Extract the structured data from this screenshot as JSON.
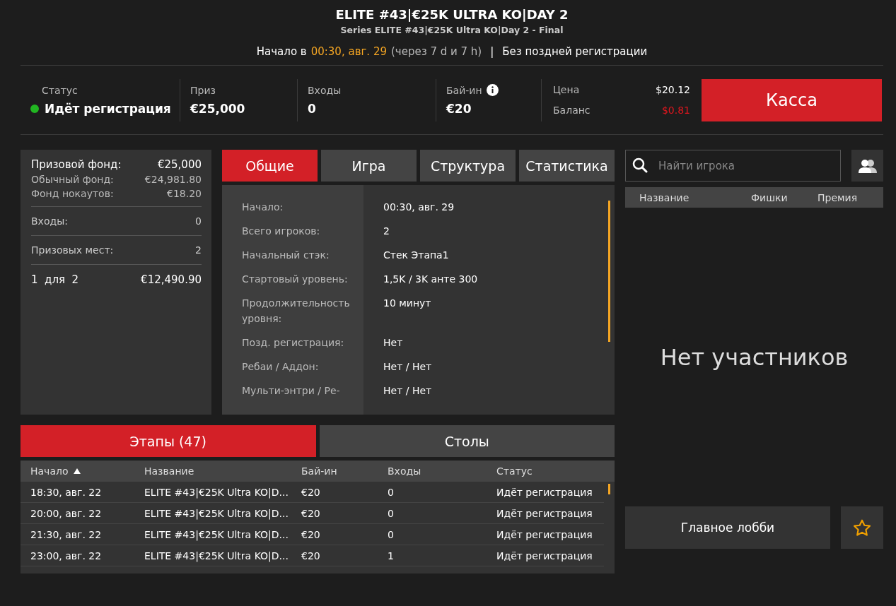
{
  "header": {
    "title": "ELITE #43|€25K ULTRA KO|DAY 2",
    "subtitle": "Series ELITE #43|€25K Ultra KO|Day 2 - Final",
    "start_label": "Начало в",
    "start_time": "00:30, авг. 29",
    "countdown": "(через 7 d и 7 h)",
    "separator": "|",
    "late_reg": "Без поздней регистрации"
  },
  "stats": [
    {
      "label": "Статус",
      "value": "Идёт регистрация",
      "kind": "status",
      "color": "#21b521"
    },
    {
      "label": "Приз",
      "value": "€25,000",
      "kind": "plain"
    },
    {
      "label": "Входы",
      "value": "0",
      "kind": "plain"
    },
    {
      "label": "Бай-ин",
      "value": "€20",
      "kind": "info"
    }
  ],
  "price": {
    "label": "Цена",
    "value": "$20.12"
  },
  "balance": {
    "label": "Баланс",
    "value": "$0.81"
  },
  "cashier_button": "Касса",
  "prize_panel": {
    "groups": [
      [
        {
          "label": "Призовой фонд:",
          "value": "€25,000",
          "kind": "main"
        },
        {
          "label": "Обычный фонд:",
          "value": "€24,981.80",
          "kind": "sub"
        },
        {
          "label": "Фонд нокаутов:",
          "value": "€18.20",
          "kind": "sub"
        }
      ],
      [
        {
          "label": "Входы:",
          "value": "0",
          "kind": "plain"
        }
      ],
      [
        {
          "label": "Призовых мест:",
          "value": "2",
          "kind": "plain"
        }
      ],
      [
        {
          "label": "1  для  2",
          "value": "€12,490.90",
          "kind": "main"
        }
      ]
    ]
  },
  "info_tabs": [
    {
      "label": "Общие",
      "selected": true
    },
    {
      "label": "Игра",
      "selected": false
    },
    {
      "label": "Структура",
      "selected": false
    },
    {
      "label": "Статистика",
      "selected": false
    }
  ],
  "info_rows": [
    {
      "label": "Начало:",
      "value": "00:30, авг. 29"
    },
    {
      "label": "Всего игроков:",
      "value": "2"
    },
    {
      "label": "Начальный стэк:",
      "value": "Стек Этапа1"
    },
    {
      "label": "Стартовый уровень:",
      "value": "1,5K / 3K анте 300"
    },
    {
      "label": "Продолжительность уровня:",
      "value": "10 минут"
    },
    {
      "label": "Позд. регистрация:",
      "value": "Нет"
    },
    {
      "label": "Ребаи / Аддон:",
      "value": "Нет / Нет"
    },
    {
      "label": "Мульти-энтри / Ре-",
      "value": "Нет / Нет"
    }
  ],
  "bottom_tabs": [
    {
      "label": "Этапы (47)",
      "selected": true
    },
    {
      "label": "Столы",
      "selected": false
    }
  ],
  "stages_table": {
    "columns": [
      {
        "label": "Начало",
        "sorted": true
      },
      {
        "label": "Название",
        "sorted": false
      },
      {
        "label": "Бай-ин",
        "sorted": false
      },
      {
        "label": "Входы",
        "sorted": false
      },
      {
        "label": "Статус",
        "sorted": false
      }
    ],
    "rows": [
      [
        "18:30, авг. 22",
        "ELITE #43|€25K Ultra KO|D...",
        "€20",
        "0",
        "Идёт регистрация"
      ],
      [
        "20:00, авг. 22",
        "ELITE #43|€25K Ultra KO|D...",
        "€20",
        "0",
        "Идёт регистрация"
      ],
      [
        "21:30, авг. 22",
        "ELITE #43|€25K Ultra KO|D...",
        "€20",
        "0",
        "Идёт регистрация"
      ],
      [
        "23:00, авг. 22",
        "ELITE #43|€25K Ultra KO|D...",
        "€20",
        "1",
        "Идёт регистрация"
      ]
    ]
  },
  "players": {
    "search": {
      "placeholder": "Найти игрока"
    },
    "columns": [
      "Название",
      "Фишки",
      "Премия"
    ],
    "empty_message": "Нет участников"
  },
  "lobby_button": "Главное лобби"
}
